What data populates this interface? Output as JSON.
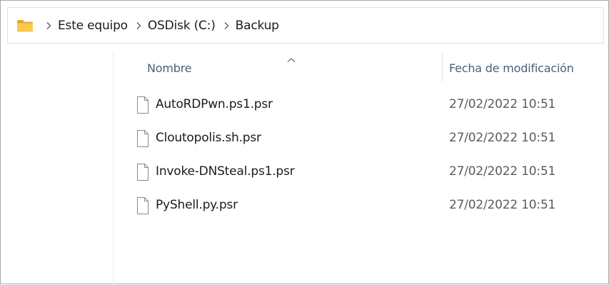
{
  "address_bar": {
    "icon": "folder-icon",
    "breadcrumbs": [
      "Este equipo",
      "OSDisk (C:)",
      "Backup"
    ],
    "separator_icon": "chevron-right-icon"
  },
  "columns": {
    "name_label": "Nombre",
    "date_label": "Fecha de modificación",
    "sort_indicator": "chevron-up-icon"
  },
  "files": [
    {
      "name": "AutoRDPwn.ps1.psr",
      "modified": "27/02/2022 10:51",
      "icon": "file-icon"
    },
    {
      "name": "Cloutopolis.sh.psr",
      "modified": "27/02/2022 10:51",
      "icon": "file-icon"
    },
    {
      "name": "Invoke-DNSteal.ps1.psr",
      "modified": "27/02/2022 10:51",
      "icon": "file-icon"
    },
    {
      "name": "PyShell.py.psr",
      "modified": "27/02/2022 10:51",
      "icon": "file-icon"
    }
  ],
  "colors": {
    "folder_yellow": "#f5c244",
    "header_text": "#4c607a",
    "border": "#a8a8a8"
  }
}
